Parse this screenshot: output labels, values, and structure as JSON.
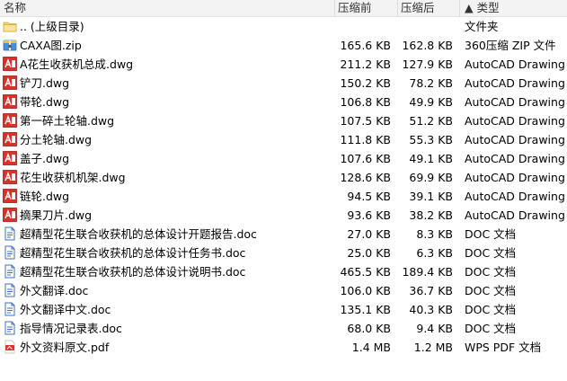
{
  "columns": {
    "name": "名称",
    "packed": "压缩前",
    "compressed": "压缩后",
    "sort_indicator": "▲",
    "type": "类型"
  },
  "files": [
    {
      "name": ".. (上级目录)",
      "packed": "",
      "compressed": "",
      "type": "文件夹",
      "icon": "folder-icon"
    },
    {
      "name": "CAXA图.zip",
      "packed": "165.6 KB",
      "compressed": "162.8 KB",
      "type": "360压缩 ZIP 文件",
      "icon": "zip-archive-icon"
    },
    {
      "name": "A花生收获机总成.dwg",
      "packed": "211.2 KB",
      "compressed": "127.9 KB",
      "type": "AutoCAD Drawing",
      "icon": "dwg-file-icon"
    },
    {
      "name": "铲刀.dwg",
      "packed": "150.2 KB",
      "compressed": "78.2 KB",
      "type": "AutoCAD Drawing",
      "icon": "dwg-file-icon"
    },
    {
      "name": "带轮.dwg",
      "packed": "106.8 KB",
      "compressed": "49.9 KB",
      "type": "AutoCAD Drawing",
      "icon": "dwg-file-icon"
    },
    {
      "name": "第一碎土轮轴.dwg",
      "packed": "107.5 KB",
      "compressed": "51.2 KB",
      "type": "AutoCAD Drawing",
      "icon": "dwg-file-icon"
    },
    {
      "name": "分土轮轴.dwg",
      "packed": "111.8 KB",
      "compressed": "55.3 KB",
      "type": "AutoCAD Drawing",
      "icon": "dwg-file-icon"
    },
    {
      "name": "盖子.dwg",
      "packed": "107.6 KB",
      "compressed": "49.1 KB",
      "type": "AutoCAD Drawing",
      "icon": "dwg-file-icon"
    },
    {
      "name": "花生收获机机架.dwg",
      "packed": "128.6 KB",
      "compressed": "69.9 KB",
      "type": "AutoCAD Drawing",
      "icon": "dwg-file-icon"
    },
    {
      "name": "链轮.dwg",
      "packed": "94.5 KB",
      "compressed": "39.1 KB",
      "type": "AutoCAD Drawing",
      "icon": "dwg-file-icon"
    },
    {
      "name": "摘果刀片.dwg",
      "packed": "93.6 KB",
      "compressed": "38.2 KB",
      "type": "AutoCAD Drawing",
      "icon": "dwg-file-icon"
    },
    {
      "name": "超精型花生联合收获机的总体设计开题报告.doc",
      "packed": "27.0 KB",
      "compressed": "8.3 KB",
      "type": "DOC 文档",
      "icon": "doc-file-icon"
    },
    {
      "name": "超精型花生联合收获机的总体设计任务书.doc",
      "packed": "25.0 KB",
      "compressed": "6.3 KB",
      "type": "DOC 文档",
      "icon": "doc-file-icon"
    },
    {
      "name": "超精型花生联合收获机的总体设计说明书.doc",
      "packed": "465.5 KB",
      "compressed": "189.4 KB",
      "type": "DOC 文档",
      "icon": "doc-file-icon"
    },
    {
      "name": "外文翻译.doc",
      "packed": "106.0 KB",
      "compressed": "36.7 KB",
      "type": "DOC 文档",
      "icon": "doc-file-icon"
    },
    {
      "name": "外文翻译中文.doc",
      "packed": "135.1 KB",
      "compressed": "40.3 KB",
      "type": "DOC 文档",
      "icon": "doc-file-icon"
    },
    {
      "name": "指导情况记录表.doc",
      "packed": "68.0 KB",
      "compressed": "9.4 KB",
      "type": "DOC 文档",
      "icon": "doc-file-icon"
    },
    {
      "name": "外文资料原文.pdf",
      "packed": "1.4 MB",
      "compressed": "1.2 MB",
      "type": "WPS PDF 文档",
      "icon": "pdf-file-icon"
    }
  ],
  "colors": {
    "header_bg": "#f3f3f3",
    "dwg_red": "#d6322a",
    "doc_blue": "#3b6fc4",
    "pdf_red": "#d9312b",
    "folder_yellow": "#f5d57a"
  }
}
